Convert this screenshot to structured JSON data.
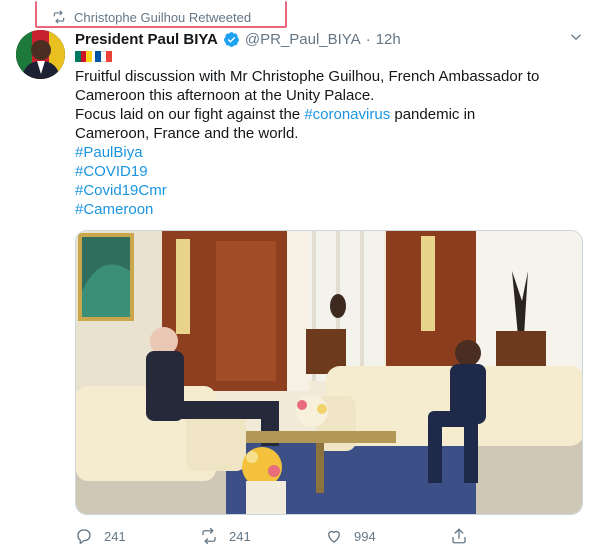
{
  "retweet_bar": {
    "icon": "retweet-icon",
    "text": "Christophe Guilhou Retweeted"
  },
  "tweet": {
    "author": {
      "name": "President Paul BIYA",
      "handle": "@PR_Paul_BIYA",
      "separator": "·",
      "time": "12h",
      "verified": true
    },
    "flags": [
      "cameroon-flag",
      "france-flag"
    ],
    "lines": {
      "l1": "Fruitful discussion with Mr Christophe Guilhou, French Ambassador to",
      "l2": "Cameroon this afternoon at the Unity Palace.",
      "l3_pre": "Focus laid on our fight against the ",
      "l3_tag": "#coronavirus",
      "l3_post": " pandemic in",
      "l4": "Cameroon, France and the world."
    },
    "hashtags": [
      "#PaulBiya",
      "#COVID19",
      "#Covid19Cmr",
      "#Cameroon"
    ],
    "actions": {
      "reply_count": "241",
      "retweet_count": "241",
      "like_count": "994"
    }
  },
  "colors": {
    "link": "#1b95e0",
    "muted": "#657786",
    "highlight": "#e8677a"
  }
}
